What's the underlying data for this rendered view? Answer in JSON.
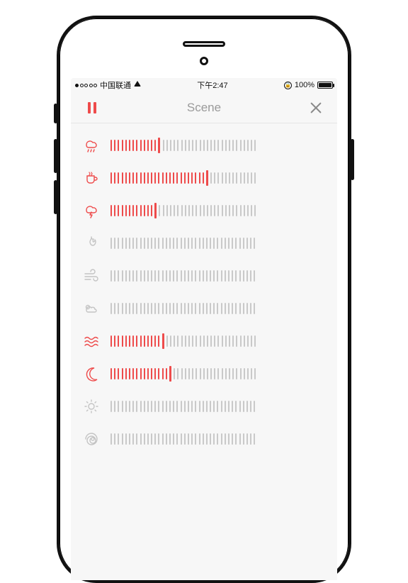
{
  "status": {
    "carrier": "中国联通",
    "time": "下午2:47",
    "battery_pct": "100%",
    "signal_filled": 1,
    "signal_total": 5
  },
  "nav": {
    "title": "Scene",
    "left_action": "pause",
    "right_action": "close"
  },
  "slider_ticks": 40,
  "sounds": [
    {
      "id": "rain",
      "icon": "rain",
      "active": true,
      "value": 13
    },
    {
      "id": "coffee",
      "icon": "coffee",
      "active": true,
      "value": 26
    },
    {
      "id": "thunder",
      "icon": "thunder",
      "active": true,
      "value": 12
    },
    {
      "id": "fire",
      "icon": "fire",
      "active": false,
      "value": 0
    },
    {
      "id": "wind",
      "icon": "wind",
      "active": false,
      "value": 0
    },
    {
      "id": "clouds",
      "icon": "clouds",
      "active": false,
      "value": 0
    },
    {
      "id": "waves",
      "icon": "waves",
      "active": true,
      "value": 14
    },
    {
      "id": "moon",
      "icon": "moon",
      "active": true,
      "value": 16
    },
    {
      "id": "sun",
      "icon": "sun",
      "active": false,
      "value": 0
    },
    {
      "id": "spiral",
      "icon": "spiral",
      "active": false,
      "value": 0
    }
  ],
  "colors": {
    "accent": "#ee4b4b",
    "inactive": "#c4c4c4",
    "tick_off": "#c9c9c9",
    "title": "#9a9a9a"
  }
}
